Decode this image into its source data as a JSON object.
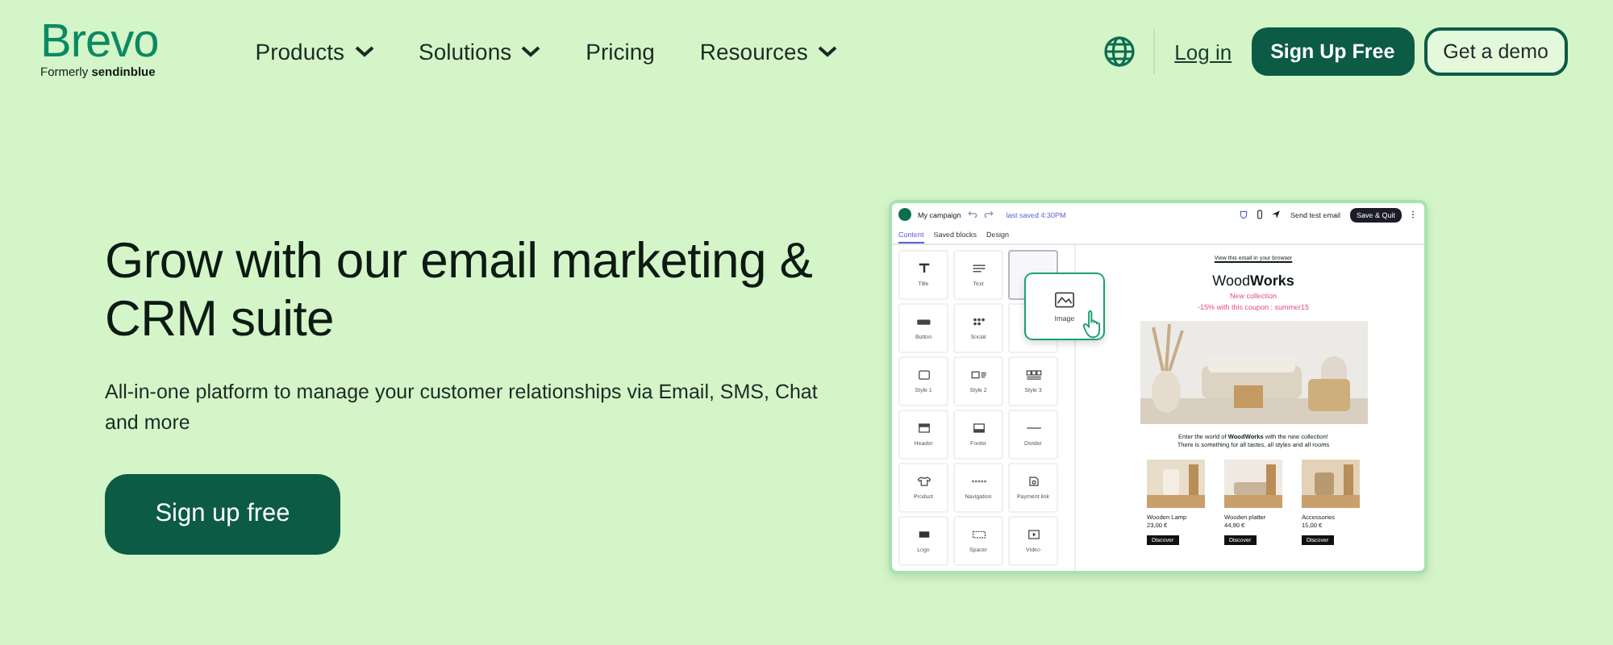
{
  "header": {
    "logo": "Brevo",
    "tagline_prefix": "Formerly",
    "tagline_brand": "sendinblue",
    "nav": [
      {
        "label": "Products",
        "dropdown": true
      },
      {
        "label": "Solutions",
        "dropdown": true
      },
      {
        "label": "Pricing",
        "dropdown": false
      },
      {
        "label": "Resources",
        "dropdown": true
      }
    ],
    "login": "Log in",
    "signup": "Sign Up Free",
    "demo": "Get a demo"
  },
  "hero": {
    "title": "Grow with our email marketing & CRM suite",
    "subtitle": "All-in-one platform to manage your customer relationships via Email, SMS, Chat and more",
    "cta": "Sign up free"
  },
  "editor": {
    "campaign": "My campaign",
    "saved": "last saved 4:30PM",
    "test_button": "Send test email",
    "save_button": "Save & Quit",
    "tabs": [
      {
        "label": "Content",
        "selected": true
      },
      {
        "label": "Saved blocks",
        "selected": false
      },
      {
        "label": "Design",
        "selected": false
      }
    ],
    "blocks": [
      {
        "kind": "title",
        "label": "Title",
        "selected": false
      },
      {
        "kind": "text",
        "label": "Text",
        "selected": false
      },
      {
        "kind": "empty",
        "selected": true
      },
      {
        "kind": "button",
        "label": "Button",
        "selected": false
      },
      {
        "kind": "social",
        "label": "Social",
        "selected": false
      },
      {
        "kind": "empty",
        "selected": false
      },
      {
        "kind": "columns1",
        "label": "Style 1",
        "selected": false
      },
      {
        "kind": "columns2",
        "label": "Style 2",
        "selected": false
      },
      {
        "kind": "columns3",
        "label": "Style 3",
        "selected": false
      },
      {
        "kind": "header",
        "label": "Header",
        "selected": false
      },
      {
        "kind": "footer",
        "label": "Footer",
        "selected": false
      },
      {
        "kind": "divider",
        "label": "Divider",
        "selected": false
      },
      {
        "kind": "product",
        "label": "Product",
        "selected": false
      },
      {
        "kind": "navigation",
        "label": "Navigation",
        "selected": false
      },
      {
        "kind": "payment",
        "label": "Payment link",
        "selected": false
      },
      {
        "kind": "logo",
        "label": "Logo",
        "selected": false
      },
      {
        "kind": "spacer",
        "label": "Spacer",
        "selected": false
      },
      {
        "kind": "video",
        "label": "Video",
        "selected": false
      }
    ],
    "dragged_block": "Image",
    "email": {
      "top_line": "View this email in your browser",
      "brand": "Wood**Works**",
      "headline": "New collection",
      "coupon": "-15% with this coupon : summer15",
      "intro": [
        "Enter the world of **WoodWorks** with the new collection!",
        "There is something for all tastes, all styles and all rooms"
      ],
      "products": [
        {
          "name": "Wooden Lamp",
          "price": "23,00 €",
          "button": "Discover"
        },
        {
          "name": "Wooden platter",
          "price": "44,90 €",
          "button": "Discover"
        },
        {
          "name": "Accessories",
          "price": "15,00 €",
          "button": "Discover"
        }
      ]
    }
  }
}
